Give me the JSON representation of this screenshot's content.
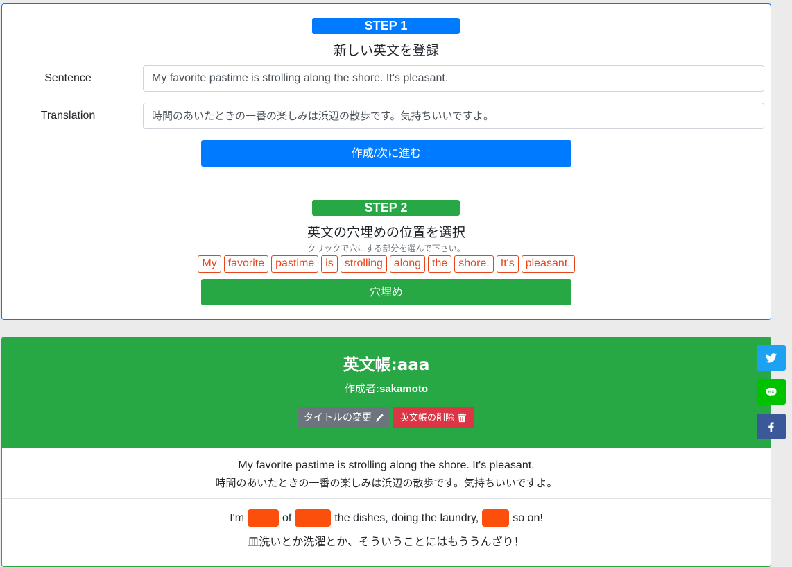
{
  "step1": {
    "badge": "STEP 1",
    "title": "新しい英文を登録",
    "sentence_label": "Sentence",
    "sentence_value": "My favorite pastime is strolling along the shore. It's pleasant.",
    "translation_label": "Translation",
    "translation_value": "時間のあいたときの一番の楽しみは浜辺の散歩です。気持ちいいですよ。",
    "submit_label": "作成/次に進む",
    "accent_color": "#007bff"
  },
  "step2": {
    "badge": "STEP 2",
    "title": "英文の穴埋めの位置を選択",
    "hint": "クリックで穴にする部分を選んで下さい。",
    "words": [
      "My",
      "favorite",
      "pastime",
      "is",
      "strolling",
      "along",
      "the",
      "shore.",
      "It's",
      "pleasant."
    ],
    "submit_label": "穴埋め",
    "accent_color": "#28a745"
  },
  "book": {
    "title": "英文帳:aaa",
    "author_prefix": "作成者:",
    "author_name": "sakamoto",
    "rename_label": "タイトルの変更",
    "rename_icon": "pencil-icon",
    "delete_label": "英文帳の削除",
    "delete_icon": "trash-icon",
    "entries": [
      {
        "english": "My favorite pastime is strolling along the shore. It's pleasant.",
        "japanese": "時間のあいたときの一番の楽しみは浜辺の散歩です。気持ちいいですよ。"
      },
      {
        "english_parts": [
          "I'm",
          "of",
          "the dishes, doing the laundry,",
          "so on!"
        ],
        "blank_color": "#fd4f0c",
        "japanese": "皿洗いとか洗濯とか、そういうことにはもううんざり！"
      }
    ]
  },
  "share": {
    "twitter_icon": "twitter-icon",
    "line_icon": "line-icon",
    "facebook_icon": "facebook-icon",
    "twitter_color": "#1da1f2",
    "line_color": "#00c300",
    "facebook_color": "#3b5998"
  }
}
